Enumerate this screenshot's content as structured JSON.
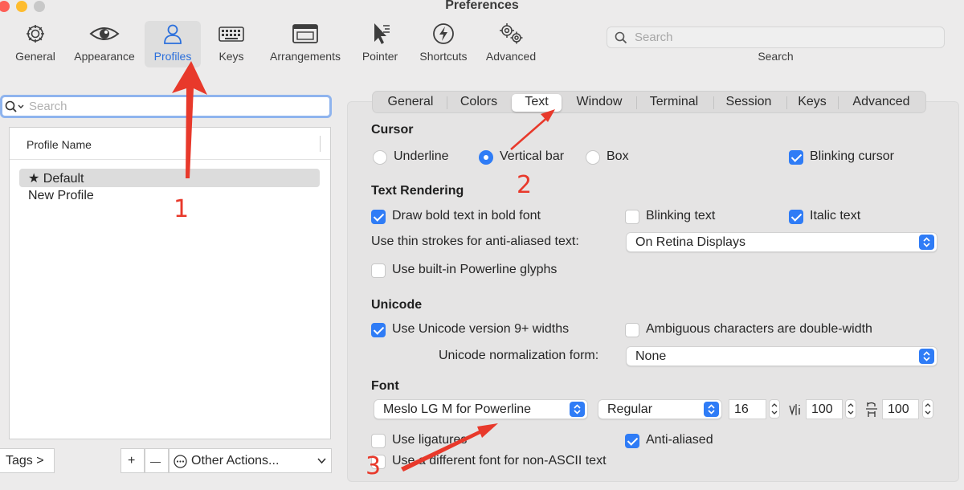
{
  "window": {
    "title": "Preferences",
    "traffic_colors": [
      "#fd5f57",
      "#febc2e",
      "#c8c8c8"
    ]
  },
  "toolbar": {
    "items": [
      {
        "label": "General",
        "icon": "gear-icon"
      },
      {
        "label": "Appearance",
        "icon": "eye-icon"
      },
      {
        "label": "Profiles",
        "icon": "person-icon",
        "active": true
      },
      {
        "label": "Keys",
        "icon": "keyboard-icon"
      },
      {
        "label": "Arrangements",
        "icon": "windows-icon"
      },
      {
        "label": "Pointer",
        "icon": "pointer-icon"
      },
      {
        "label": "Shortcuts",
        "icon": "lightning-icon"
      },
      {
        "label": "Advanced",
        "icon": "gears-icon"
      }
    ],
    "search_placeholder": "Search",
    "search_label": "Search"
  },
  "profiles": {
    "search_placeholder": "Search",
    "column_header": "Profile Name",
    "items": [
      {
        "label": "Default",
        "starred": true,
        "selected": true
      },
      {
        "label": "New Profile"
      }
    ],
    "tags_button": "Tags >",
    "add_button": "+",
    "remove_button": "—",
    "other_actions": "Other Actions..."
  },
  "tabs": [
    "General",
    "Colors",
    "Text",
    "Window",
    "Terminal",
    "Session",
    "Keys",
    "Advanced"
  ],
  "active_tab": "Text",
  "cursor": {
    "heading": "Cursor",
    "options": [
      "Underline",
      "Vertical bar",
      "Box"
    ],
    "selected": "Vertical bar",
    "blinking_label": "Blinking cursor",
    "blinking": true
  },
  "text_rendering": {
    "heading": "Text Rendering",
    "bold_label": "Draw bold text in bold font",
    "bold": true,
    "blinking_text_label": "Blinking text",
    "blinking_text": false,
    "italic_label": "Italic text",
    "italic": true,
    "thin_strokes_label": "Use thin strokes for anti-aliased text:",
    "thin_strokes_value": "On Retina Displays",
    "powerline_label": "Use built-in Powerline glyphs",
    "powerline": false
  },
  "unicode": {
    "heading": "Unicode",
    "v9_label": "Use Unicode version 9+ widths",
    "v9": true,
    "ambiguous_label": "Ambiguous characters are double-width",
    "ambiguous": false,
    "normalization_label": "Unicode normalization form:",
    "normalization_value": "None"
  },
  "font": {
    "heading": "Font",
    "family": "Meslo LG M for Powerline",
    "style": "Regular",
    "size": "16",
    "h_spacing": "100",
    "v_spacing": "100",
    "ligatures_label": "Use ligatures",
    "ligatures": false,
    "antialiased_label": "Anti-aliased",
    "antialiased": true,
    "non_ascii_label": "Use a different font for non-ASCII text",
    "non_ascii": false
  },
  "annotations": {
    "one": "1",
    "two": "2",
    "three": "3",
    "color": "#e8392b"
  },
  "colors": {
    "accent": "#2f7cf6",
    "annotation": "#e8392b",
    "active_tab_label": "#2a6fdc"
  }
}
